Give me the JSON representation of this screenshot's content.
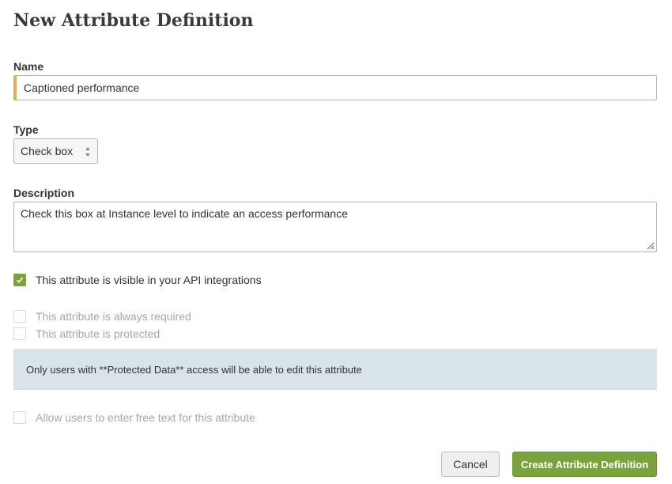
{
  "page": {
    "title": "New Attribute Definition"
  },
  "form": {
    "name": {
      "label": "Name",
      "value": "Captioned performance"
    },
    "type": {
      "label": "Type",
      "selected": "Check box"
    },
    "description": {
      "label": "Description",
      "value": "Check this box at Instance level to indicate an access performance"
    },
    "checkboxes": {
      "api_visible": {
        "label": "This attribute is visible in your API integrations",
        "checked": true
      },
      "required": {
        "label": "This attribute is always required",
        "checked": false
      },
      "protected": {
        "label": "This attribute is protected",
        "checked": false
      },
      "free_text": {
        "label": "Allow users to enter free text for this attribute",
        "checked": false
      }
    },
    "info_note": "Only users with **Protected Data** access will be able to edit this attribute"
  },
  "buttons": {
    "cancel": "Cancel",
    "create": "Create Attribute Definition"
  },
  "colors": {
    "accent": "#7aa33e",
    "name_field_marker": "#e8a95b",
    "info_background": "#d8e4ea"
  }
}
